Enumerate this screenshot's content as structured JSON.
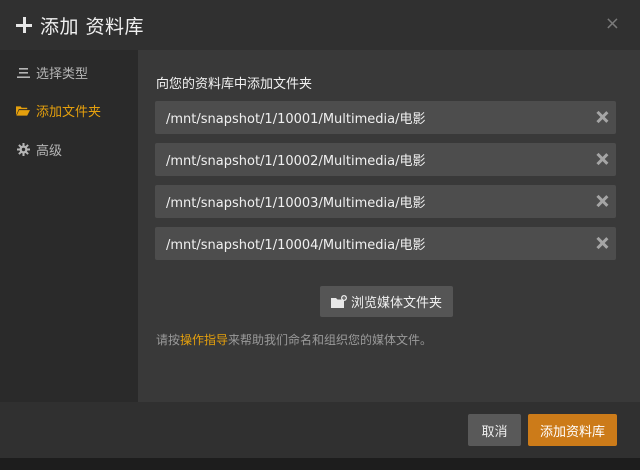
{
  "header": {
    "title": "添加 资料库",
    "close_label": "×",
    "plus_icon": "plus-icon"
  },
  "sidebar": {
    "items": [
      {
        "label": "选择类型",
        "icon": "list-icon",
        "active": false
      },
      {
        "label": "添加文件夹",
        "icon": "folder-open-icon",
        "active": true
      },
      {
        "label": "高级",
        "icon": "gear-icon",
        "active": false
      }
    ]
  },
  "main": {
    "heading": "向您的资料库中添加文件夹",
    "folders": [
      "/mnt/snapshot/1/10001/Multimedia/电影",
      "/mnt/snapshot/1/10002/Multimedia/电影",
      "/mnt/snapshot/1/10003/Multimedia/电影",
      "/mnt/snapshot/1/10004/Multimedia/电影"
    ],
    "browse_label": "浏览媒体文件夹",
    "help": {
      "prefix": "请按",
      "link": "操作指导",
      "suffix": "来帮助我们命名和组织您的媒体文件。"
    }
  },
  "footer": {
    "cancel_label": "取消",
    "add_label": "添加资料库"
  },
  "colors": {
    "accent": "#e5a00d",
    "primary_button": "#cc7b19"
  }
}
